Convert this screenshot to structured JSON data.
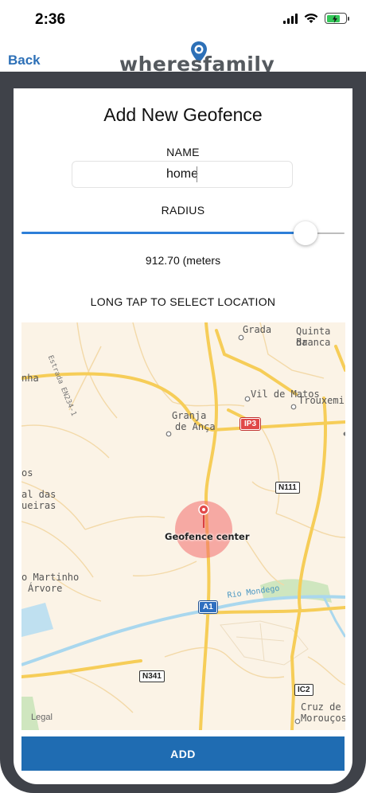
{
  "status_bar": {
    "time": "2:36"
  },
  "nav": {
    "back_label": "Back",
    "logo_text": "wheresfamily"
  },
  "form": {
    "title": "Add New Geofence",
    "name_label": "NAME",
    "name_value": "home",
    "radius_label": "RADIUS",
    "radius_value": "912.70 (meters",
    "radius_slider_fraction": 0.88,
    "instruction": "LONG TAP TO SELECT LOCATION"
  },
  "map": {
    "places": {
      "grada": "Grada",
      "quinta_1": "Quinta da",
      "quinta_2": "Branca",
      "estrada": "Estrada EN234-1",
      "nha": "nha",
      "vil_de_matos": "Vil de Matos",
      "trouxemi": "Trouxemi",
      "granja_1": "Granja",
      "granja_2": "de Ança",
      "os": "os",
      "al_das_1": "al das",
      "al_das_2": "ueiras",
      "martinho_1": "o Martinho",
      "martinho_2": "Árvore",
      "rio_mondego": "Rio Mondego",
      "cruz_1": "Cruz de",
      "cruz_2": "Morouços"
    },
    "road_shields": {
      "ip3": "IP3",
      "n111": "N111",
      "a1": "A1",
      "n341": "N341",
      "ic2": "IC2"
    },
    "marker_label": "Geofence center",
    "legal": "Legal"
  },
  "add_button_label": "ADD",
  "colors": {
    "accent": "#1f6cb2",
    "frame": "#3f4249",
    "slider": "#2d7fd8",
    "geofence": "#f26b6b"
  }
}
